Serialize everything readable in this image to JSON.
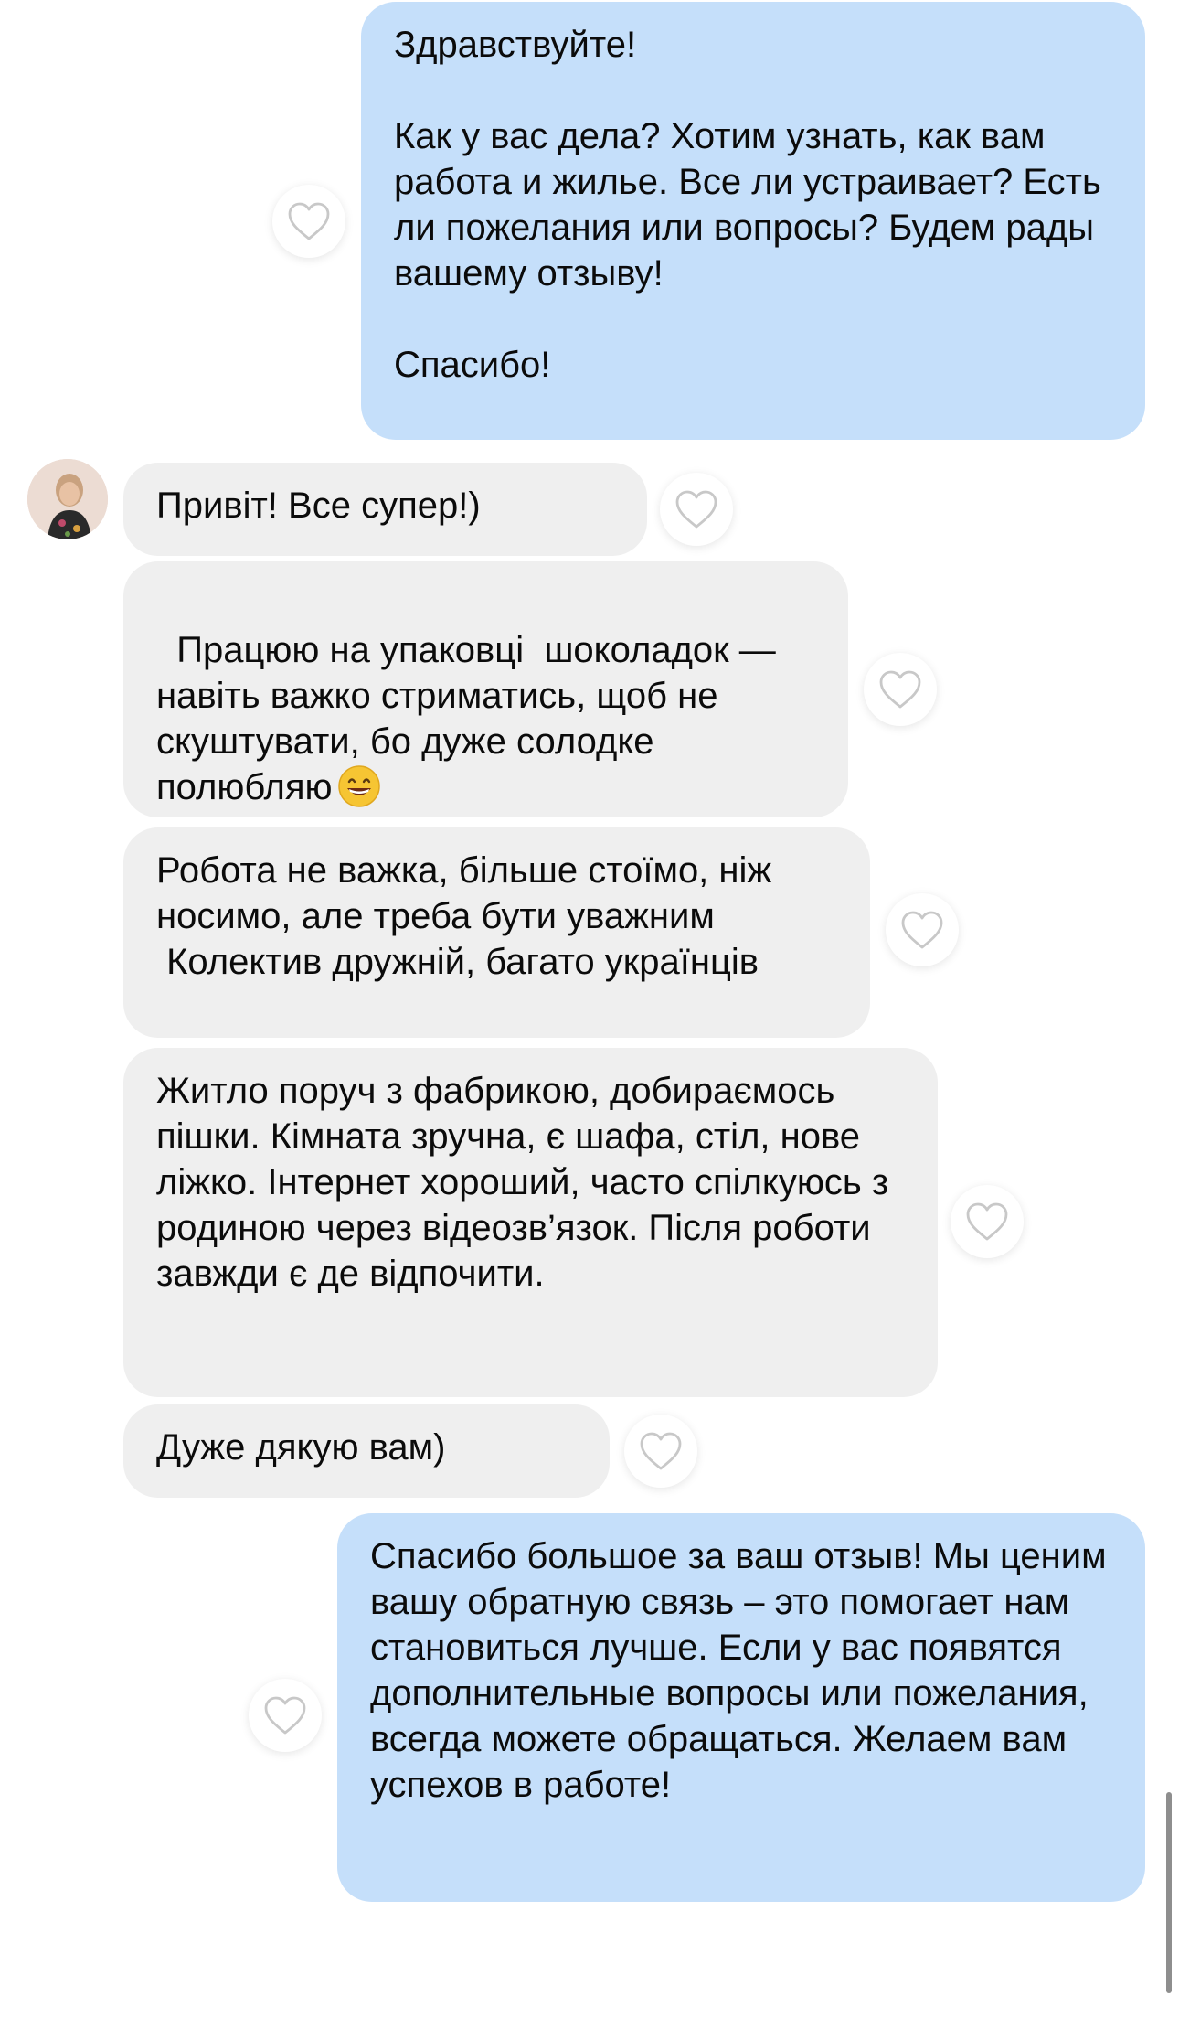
{
  "messages": [
    {
      "direction": "outgoing",
      "text": "Здравствуйте!\n\nКак у вас дела? Хотим узнать, как вам работа и жилье. Все ли устраивает? Есть ли пожелания или вопросы? Будем рады вашему отзыву!\n\nСпасибо!"
    },
    {
      "direction": "incoming",
      "text": "Привіт! Все супер!)"
    },
    {
      "direction": "incoming",
      "text": "Працюю на упаковці  шоколадок — навіть важко стриматись, щоб не скуштувати, бо дуже солодке полюбляю",
      "emoji": "grinning-face-emoji"
    },
    {
      "direction": "incoming",
      "text": "Робота не важка, більше стоїмо, ніж носимо, але треба бути уважним\n Колектив дружній, багато українців"
    },
    {
      "direction": "incoming",
      "text": "Житло поруч з фабрикою, добираємось пішки. Кімната зручна, є шафа, стіл, нове ліжко. Інтернет хороший, часто спілкуюсь з родиною через відеозв’язок. Після роботи завжди є де відпочити."
    },
    {
      "direction": "incoming",
      "text": "Дуже дякую вам)"
    },
    {
      "direction": "outgoing",
      "text": "Спасибо большое за ваш отзыв! Мы ценим вашу обратную связь – это помогает нам становиться лучше. Если у вас появятся дополнительные вопросы или пожелания, всегда можете обращаться. Желаем вам успехов в работе!"
    }
  ],
  "icons": {
    "like": "heart-outline-icon",
    "avatar": "contact-avatar"
  },
  "colors": {
    "outgoing_bubble": "#c5dffa",
    "incoming_bubble": "#efefef",
    "heart_stroke": "#c8c8c8"
  }
}
